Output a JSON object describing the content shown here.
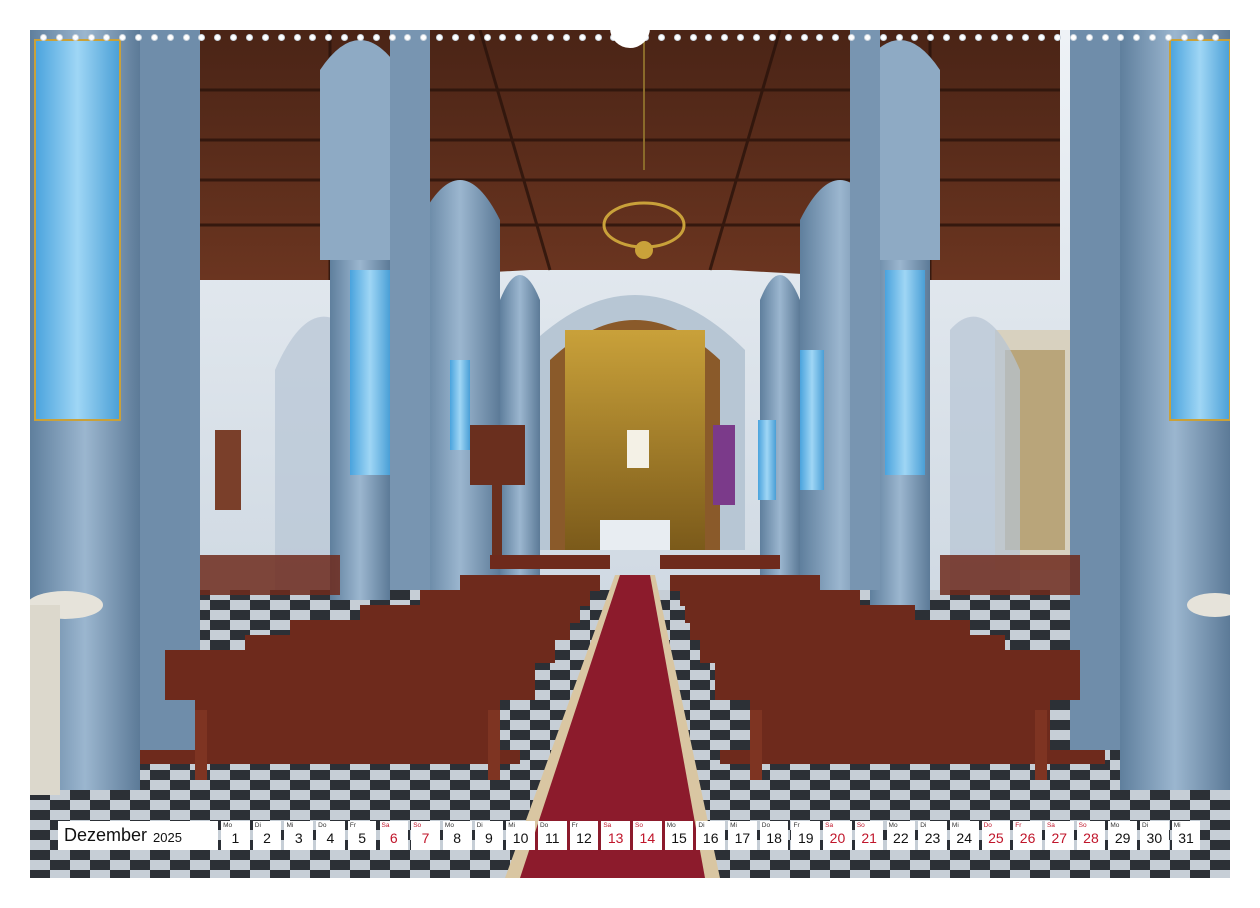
{
  "calendar": {
    "month": "Dezember",
    "year": "2025",
    "days": [
      {
        "weekday": "Mo",
        "day": "1",
        "weekend": false
      },
      {
        "weekday": "Di",
        "day": "2",
        "weekend": false
      },
      {
        "weekday": "Mi",
        "day": "3",
        "weekend": false
      },
      {
        "weekday": "Do",
        "day": "4",
        "weekend": false
      },
      {
        "weekday": "Fr",
        "day": "5",
        "weekend": false
      },
      {
        "weekday": "Sa",
        "day": "6",
        "weekend": true
      },
      {
        "weekday": "So",
        "day": "7",
        "weekend": true
      },
      {
        "weekday": "Mo",
        "day": "8",
        "weekend": false
      },
      {
        "weekday": "Di",
        "day": "9",
        "weekend": false
      },
      {
        "weekday": "Mi",
        "day": "10",
        "weekend": false
      },
      {
        "weekday": "Do",
        "day": "11",
        "weekend": false
      },
      {
        "weekday": "Fr",
        "day": "12",
        "weekend": false
      },
      {
        "weekday": "Sa",
        "day": "13",
        "weekend": true
      },
      {
        "weekday": "So",
        "day": "14",
        "weekend": true
      },
      {
        "weekday": "Mo",
        "day": "15",
        "weekend": false
      },
      {
        "weekday": "Di",
        "day": "16",
        "weekend": false
      },
      {
        "weekday": "Mi",
        "day": "17",
        "weekend": false
      },
      {
        "weekday": "Do",
        "day": "18",
        "weekend": false
      },
      {
        "weekday": "Fr",
        "day": "19",
        "weekend": false
      },
      {
        "weekday": "Sa",
        "day": "20",
        "weekend": true
      },
      {
        "weekday": "So",
        "day": "21",
        "weekend": true
      },
      {
        "weekday": "Mo",
        "day": "22",
        "weekend": false
      },
      {
        "weekday": "Di",
        "day": "23",
        "weekend": false
      },
      {
        "weekday": "Mi",
        "day": "24",
        "weekend": false
      },
      {
        "weekday": "Do",
        "day": "25",
        "weekend": true
      },
      {
        "weekday": "Fr",
        "day": "26",
        "weekend": true
      },
      {
        "weekday": "Sa",
        "day": "27",
        "weekend": true
      },
      {
        "weekday": "So",
        "day": "28",
        "weekend": true
      },
      {
        "weekday": "Mo",
        "day": "29",
        "weekend": false
      },
      {
        "weekday": "Di",
        "day": "30",
        "weekend": false
      },
      {
        "weekday": "Mi",
        "day": "31",
        "weekend": false
      }
    ]
  },
  "colors": {
    "holiday_red": "#c0152a",
    "column_blue": "#7f9fbd",
    "banner_blue": "#6fb8e6",
    "pew_brown": "#6e2a1c",
    "carpet_red": "#8c1b2c"
  }
}
